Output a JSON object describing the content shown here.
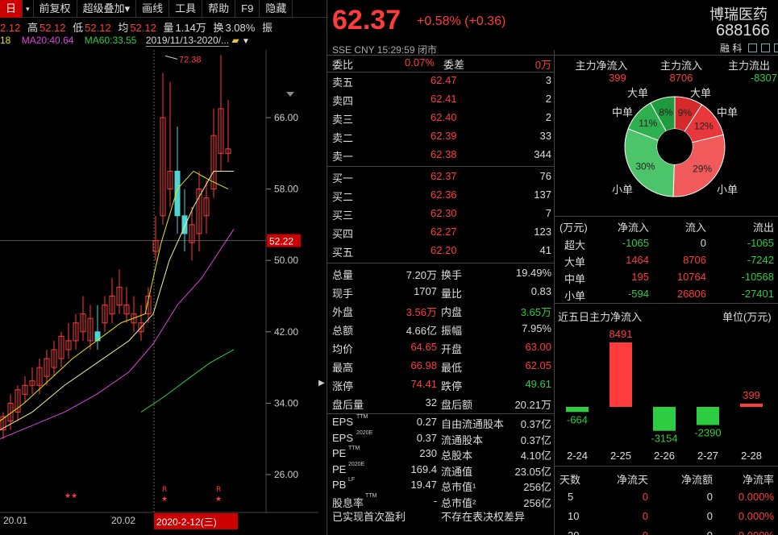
{
  "toolbar": {
    "items": [
      "日",
      "▾",
      "前复权",
      "超级叠加▾",
      "画线",
      "工具",
      "帮助",
      "F9",
      "隐藏"
    ]
  },
  "info": {
    "open_label": "2.12",
    "high_label": "高",
    "high": "52.12",
    "low_label": "低",
    "low": "52.12",
    "avg_label": "均",
    "avg": "52.12",
    "vol_label": "量",
    "vol": "1.14万",
    "turn_label": "换",
    "turn": "3.08%",
    "amp_label": "振"
  },
  "ma": {
    "ma_prefix": "18",
    "ma20": "MA20:40.64",
    "ma60": "MA60:33.55",
    "range": "2019/11/13-2020/..."
  },
  "chart": {
    "price_ticks": [
      "66.00",
      "58.00",
      "50.00",
      "42.00",
      "34.00",
      "26.00"
    ],
    "current_price_label": "52.22",
    "high_marker": "72.38",
    "x_labels": [
      "20.01",
      "20.02"
    ],
    "cursor_date": "2020-2-12(三)",
    "flags": [
      "★★",
      "R",
      "R"
    ]
  },
  "quote": {
    "price": "62.37",
    "change": "+0.58% (+0.36)",
    "name": "博瑞医药",
    "code": "688166",
    "sub": "SSE  CNY  15:29:59  闭市",
    "badges": [
      "融",
      "科"
    ]
  },
  "committee": {
    "ratio_label": "委比",
    "ratio": "0.07%",
    "diff_label": "委差",
    "diff": "0万"
  },
  "asks": [
    {
      "label": "卖五",
      "price": "62.47",
      "vol": "3"
    },
    {
      "label": "卖四",
      "price": "62.41",
      "vol": "2"
    },
    {
      "label": "卖三",
      "price": "62.40",
      "vol": "2"
    },
    {
      "label": "卖二",
      "price": "62.39",
      "vol": "33"
    },
    {
      "label": "卖一",
      "price": "62.38",
      "vol": "344"
    }
  ],
  "bids": [
    {
      "label": "买一",
      "price": "62.37",
      "vol": "76"
    },
    {
      "label": "买二",
      "price": "62.36",
      "vol": "137"
    },
    {
      "label": "买三",
      "price": "62.30",
      "vol": "7"
    },
    {
      "label": "买四",
      "price": "62.27",
      "vol": "123"
    },
    {
      "label": "买五",
      "price": "62.20",
      "vol": "41"
    }
  ],
  "stats": [
    {
      "l1": "总量",
      "v1": "7.20万",
      "l2": "换手",
      "v2": "19.49%",
      "c1": "white",
      "c2": "white"
    },
    {
      "l1": "现手",
      "v1": "1707",
      "l2": "量比",
      "v2": "0.83",
      "c1": "white",
      "c2": "white"
    },
    {
      "l1": "外盘",
      "v1": "3.56万",
      "l2": "内盘",
      "v2": "3.65万",
      "c1": "red",
      "c2": "green"
    },
    {
      "l1": "总额",
      "v1": "4.66亿",
      "l2": "振幅",
      "v2": "7.95%",
      "c1": "white",
      "c2": "white"
    },
    {
      "l1": "均价",
      "v1": "64.65",
      "l2": "开盘",
      "v2": "63.00",
      "c1": "red",
      "c2": "red"
    },
    {
      "l1": "最高",
      "v1": "66.98",
      "l2": "最低",
      "v2": "62.05",
      "c1": "red",
      "c2": "red"
    },
    {
      "l1": "涨停",
      "v1": "74.41",
      "l2": "跌停",
      "v2": "49.61",
      "c1": "red",
      "c2": "green"
    },
    {
      "l1": "盘后量",
      "v1": "32",
      "l2": "盘后额",
      "v2": "20.21万",
      "c1": "white",
      "c2": "white"
    }
  ],
  "fin": [
    {
      "l1": "EPS",
      "s1": "TTM",
      "v1": "0.27",
      "l2": "自由流通股本",
      "v2": "0.37亿"
    },
    {
      "l1": "EPS",
      "s1": "2020E",
      "v1": "0.37",
      "l2": "流通股本",
      "v2": "0.37亿"
    },
    {
      "l1": "PE",
      "s1": "TTM",
      "v1": "230",
      "l2": "总股本",
      "v2": "4.10亿"
    },
    {
      "l1": "PE",
      "s1": "2020E",
      "v1": "169.4",
      "l2": "流通值",
      "v2": "23.05亿"
    },
    {
      "l1": "PB",
      "s1": "LF",
      "v1": "19.47",
      "l2": "总市值¹",
      "v2": "256亿"
    },
    {
      "l1": "股息率",
      "s1": "TTM",
      "v1": "-",
      "l2": "总市值²",
      "v2": "256亿"
    }
  ],
  "fin_note": {
    "left": "已实现首次盈利",
    "right": "不存在表决权差异"
  },
  "flow": {
    "h1": "主力净流入",
    "h2": "主力流入",
    "h3": "主力流出",
    "v1": "399",
    "v2": "8706",
    "v3": "-8307"
  },
  "pie": {
    "slices": [
      {
        "name": "大单",
        "pct": 9,
        "color": "#d42a2a",
        "label": "9%"
      },
      {
        "name": "中单",
        "pct": 12,
        "color": "#e8383b",
        "label": "12%"
      },
      {
        "name": "小单",
        "pct": 29,
        "color": "#f05a5a",
        "label": "29%"
      },
      {
        "name": "小单",
        "pct": 30,
        "color": "#4cc46a",
        "label": "30%"
      },
      {
        "name": "中单",
        "pct": 11,
        "color": "#2fb04f",
        "label": "11%"
      },
      {
        "name": "大单",
        "pct": 8,
        "color": "#1f9a3e",
        "label": "8%"
      }
    ],
    "labels": {
      "tl": "大单",
      "tr": "大单",
      "ml": "中单",
      "mr": "中单",
      "bl": "小单",
      "br": "小单"
    }
  },
  "flowtable": {
    "headers": [
      "(万元)",
      "净流入",
      "流入",
      "流出"
    ],
    "rows": [
      {
        "name": "超大",
        "net": "-1065",
        "in": "0",
        "out": "-1065",
        "nc": "green"
      },
      {
        "name": "大单",
        "net": "1464",
        "in": "8706",
        "out": "-7242",
        "nc": "red"
      },
      {
        "name": "中单",
        "net": "195",
        "in": "10764",
        "out": "-10568",
        "nc": "red"
      },
      {
        "name": "小单",
        "net": "-594",
        "in": "26806",
        "out": "-27401",
        "nc": "green"
      }
    ]
  },
  "five_day": {
    "title": "近五日主力净流入",
    "unit": "单位(万元)",
    "days": [
      {
        "date": "2-24",
        "value": -664
      },
      {
        "date": "2-25",
        "value": 8491
      },
      {
        "date": "2-26",
        "value": -3154
      },
      {
        "date": "2-27",
        "value": -2390
      },
      {
        "date": "2-28",
        "value": 399
      }
    ]
  },
  "days_table": {
    "headers": [
      "天数",
      "净流天",
      "净流额",
      "净流率"
    ],
    "rows": [
      {
        "d": "5",
        "n": "0",
        "a": "0",
        "r": "0.000%"
      },
      {
        "d": "10",
        "n": "0",
        "a": "0",
        "r": "0.000%"
      },
      {
        "d": "20",
        "n": "0",
        "a": "0",
        "r": "0.000%"
      }
    ]
  }
}
